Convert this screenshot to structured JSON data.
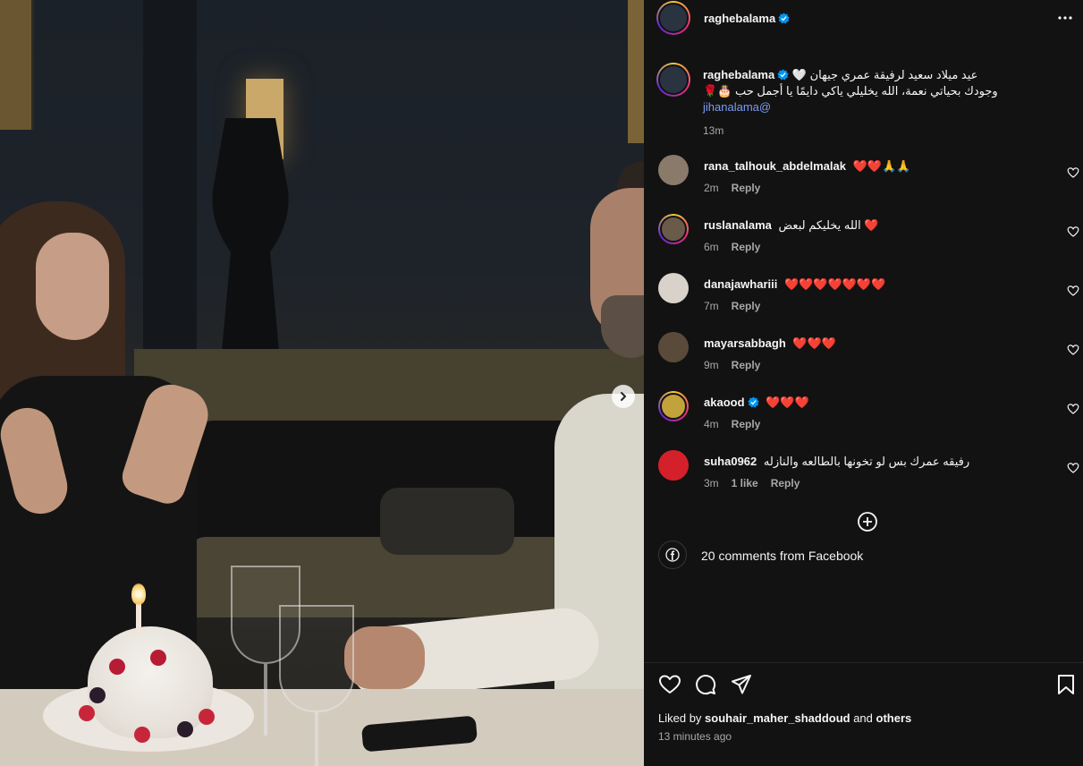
{
  "media": {
    "next_icon": "chevron-right-icon"
  },
  "header": {
    "username": "raghebalama",
    "more_icon": "more-horizontal-icon"
  },
  "caption": {
    "username": "raghebalama",
    "line1": "عيد ميلاد سعيد لرفيقة عمري جيهان 🤍",
    "line2": "وجودك بحياتي نعمة، الله يخليلي ياكي دايمًا يا أجمل حب 🎂🌹",
    "mention": "jihanalama@",
    "time": "13m"
  },
  "comments": [
    {
      "username": "rana_talhouk_abdelmalak",
      "text": "❤️❤️🙏🙏",
      "time": "2m",
      "likes": "",
      "reply": "Reply",
      "avatar_color": "#8a7a6a"
    },
    {
      "username": "ruslanalama",
      "text": "❤️ الله يخليكم لبعض",
      "time": "6m",
      "likes": "",
      "reply": "Reply",
      "avatar_color": "#6a5a4a"
    },
    {
      "username": "danajawhariii",
      "text": "❤️❤️❤️❤️❤️❤️❤️",
      "time": "7m",
      "likes": "",
      "reply": "Reply",
      "avatar_color": "#d8d2ca"
    },
    {
      "username": "mayarsabbagh",
      "text": "❤️❤️❤️",
      "time": "9m",
      "likes": "",
      "reply": "Reply",
      "avatar_color": "#5a4a3a"
    },
    {
      "username": "akaood",
      "text": "❤️❤️❤️",
      "time": "4m",
      "likes": "",
      "reply": "Reply",
      "avatar_color": "#c2a23a"
    },
    {
      "username": "suha0962",
      "text": "رفيقه عمرك بس لو تخونها بالطالعه والنازله",
      "time": "3m",
      "likes": "1 like",
      "reply": "Reply",
      "avatar_color": "#d4202a"
    }
  ],
  "facebook": {
    "label": "20 comments from Facebook"
  },
  "footer": {
    "liked_by_prefix": "Liked by ",
    "liked_by_user": "souhair_maher_shaddoud",
    "liked_by_and": " and ",
    "liked_by_others": "others",
    "time": "13 minutes ago"
  },
  "colors": {
    "background": "#121212",
    "text": "#f5f5f5",
    "muted": "#a8a8a8",
    "verified": "#0095f6",
    "mention": "#7d9bf0",
    "heart": "#ff3040"
  }
}
